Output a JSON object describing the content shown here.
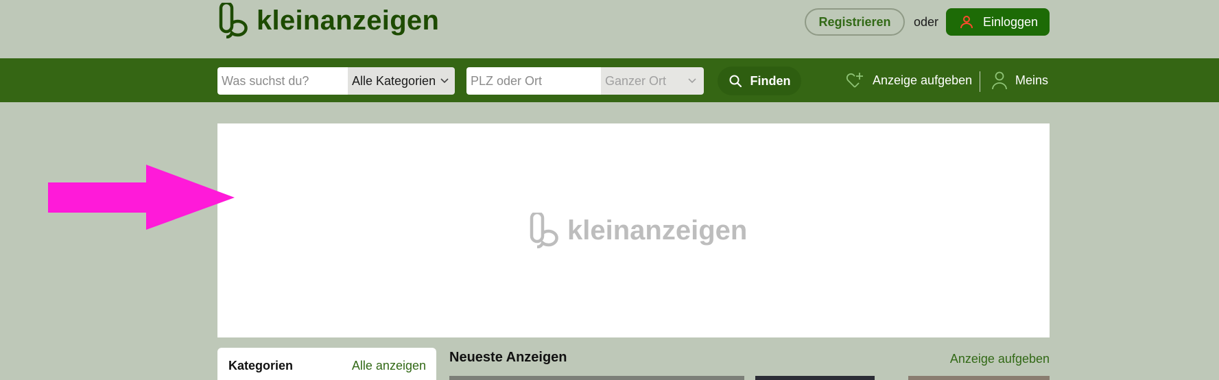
{
  "header": {
    "brand": "kleinanzeigen",
    "register_label": "Registrieren",
    "or_text": "oder",
    "login_label": "Einloggen"
  },
  "nav": {
    "search_placeholder": "Was suchst du?",
    "category_selected": "Alle Kategorien",
    "location_placeholder": "PLZ oder Ort",
    "radius_selected": "Ganzer Ort",
    "find_label": "Finden",
    "post_ad_label": "Anzeige aufgeben",
    "account_label": "Meins"
  },
  "banner": {
    "brand": "kleinanzeigen"
  },
  "sidebar": {
    "title": "Kategorien",
    "show_all_label": "Alle anzeigen"
  },
  "main": {
    "section_title": "Neueste Anzeigen",
    "post_ad_link": "Anzeige aufgeben"
  },
  "colors": {
    "page_background": "#bec8b8",
    "brand_green_dark": "#1d4b00",
    "nav_green": "#356614",
    "login_button": "#1d6b06",
    "link_green": "#326916",
    "annotation_arrow": "#ff1ad9"
  },
  "icons": {
    "logo": "kleinanzeigen-logo-icon",
    "login": "user-icon",
    "find": "search-icon",
    "post_ad": "heart-plus-icon",
    "account": "user-icon",
    "dropdown": "chevron-down-icon"
  }
}
